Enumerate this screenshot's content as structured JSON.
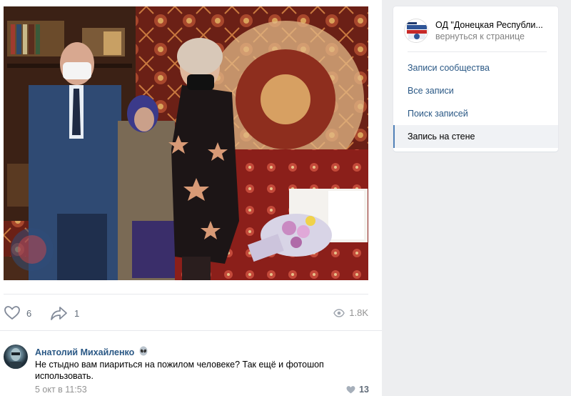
{
  "post": {
    "likes": "6",
    "shares": "1",
    "views": "1.8K"
  },
  "comment": {
    "author": "Анатолий Михайленко",
    "text": "Не стыдно вам пиариться на пожилом человеке? Так ещё и фотошоп использовать.",
    "date": "5 окт в 11:53",
    "likes": "13"
  },
  "sidebar": {
    "group_name": "ОД \"Донецкая Республи...",
    "back_link": "вернуться к странице",
    "menu": [
      {
        "label": "Записи сообщества",
        "active": false
      },
      {
        "label": "Все записи",
        "active": false
      },
      {
        "label": "Поиск записей",
        "active": false
      },
      {
        "label": "Запись на стене",
        "active": true
      }
    ]
  },
  "colors": {
    "link": "#2a5885",
    "accent": "#5181b8",
    "page_bg": "#edeef0"
  }
}
